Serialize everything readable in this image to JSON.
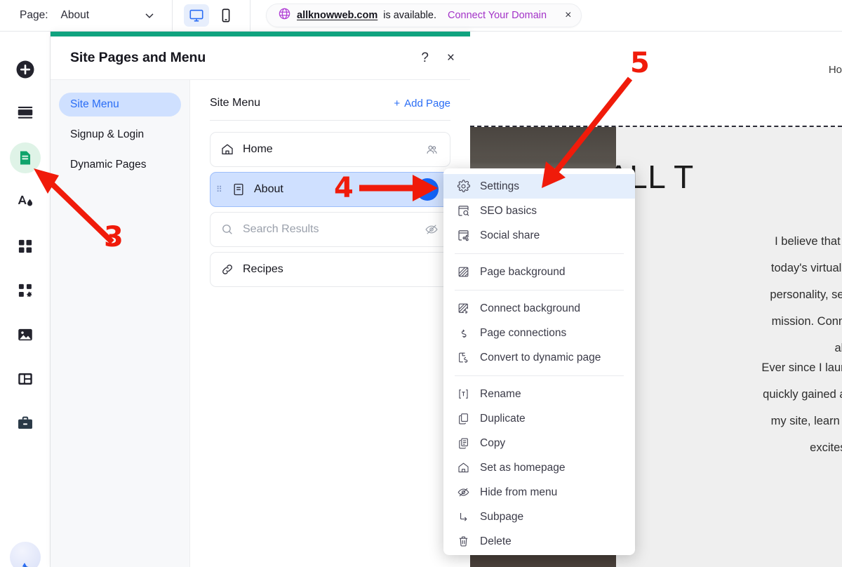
{
  "topbar": {
    "page_label": "Page:",
    "page_value": "About",
    "chevron_icon": "chevron-down-icon",
    "desktop_icon": "desktop-monitor-icon",
    "mobile_icon": "mobile-phone-icon",
    "domain": {
      "globe_icon": "globe-icon",
      "name": "allknowweb.com",
      "availability": "is available.",
      "cta": "Connect Your Domain",
      "close_icon": "×"
    }
  },
  "rail": {
    "items": [
      {
        "name": "add-icon",
        "label": "Add"
      },
      {
        "name": "sections-icon",
        "label": "Sections"
      },
      {
        "name": "pages-icon",
        "label": "Pages",
        "active": true
      },
      {
        "name": "theme-icon",
        "label": "Site Design"
      },
      {
        "name": "apps-icon",
        "label": "Apps"
      },
      {
        "name": "add-apps-icon",
        "label": "Add Apps"
      },
      {
        "name": "media-icon",
        "label": "Media"
      },
      {
        "name": "cms-icon",
        "label": "Content"
      },
      {
        "name": "business-icon",
        "label": "Business Tools"
      }
    ],
    "avatar": "user-avatar"
  },
  "panel": {
    "accent_color": "#10a37f",
    "title": "Site Pages and Menu",
    "help_icon": "?",
    "close_icon": "×",
    "nav": [
      {
        "label": "Site Menu",
        "active": true
      },
      {
        "label": "Signup & Login",
        "active": false
      },
      {
        "label": "Dynamic Pages",
        "active": false
      }
    ],
    "main": {
      "heading": "Site Menu",
      "add_page": "Add Page",
      "plus_icon": "+",
      "pages": [
        {
          "icon": "home-icon",
          "label": "Home",
          "right_icon": "members-icon",
          "state": "normal"
        },
        {
          "icon": "page-icon",
          "label": "About",
          "right_icon": "more-actions-icon",
          "state": "selected"
        },
        {
          "icon": "search-icon",
          "label": "Search Results",
          "right_icon": "hidden-eye-icon",
          "state": "muted"
        },
        {
          "icon": "link-icon",
          "label": "Recipes",
          "right_icon": "",
          "state": "normal"
        }
      ]
    }
  },
  "context_menu": {
    "groups": [
      {
        "items": [
          {
            "icon": "gear-icon",
            "label": "Settings",
            "highlighted": true
          },
          {
            "icon": "seo-icon",
            "label": "SEO basics",
            "highlighted": false
          },
          {
            "icon": "social-share-icon",
            "label": "Social share",
            "highlighted": false
          }
        ]
      },
      {
        "items": [
          {
            "icon": "page-background-icon",
            "label": "Page background",
            "highlighted": false
          }
        ]
      },
      {
        "items": [
          {
            "icon": "connect-background-icon",
            "label": "Connect background",
            "highlighted": false
          },
          {
            "icon": "page-connections-icon",
            "label": "Page connections",
            "highlighted": false
          },
          {
            "icon": "convert-dynamic-icon",
            "label": "Convert to dynamic page",
            "highlighted": false
          }
        ]
      },
      {
        "items": [
          {
            "icon": "rename-icon",
            "label": "Rename",
            "highlighted": false
          },
          {
            "icon": "duplicate-icon",
            "label": "Duplicate",
            "highlighted": false
          },
          {
            "icon": "copy-icon",
            "label": "Copy",
            "highlighted": false
          },
          {
            "icon": "home-icon",
            "label": "Set as homepage",
            "highlighted": false
          },
          {
            "icon": "hide-eye-icon",
            "label": "Hide from menu",
            "highlighted": false
          },
          {
            "icon": "subpage-icon",
            "label": "Subpage",
            "highlighted": false
          },
          {
            "icon": "trash-icon",
            "label": "Delete",
            "highlighted": false
          }
        ]
      }
    ]
  },
  "preview": {
    "nav_text": "Ho",
    "heading": "ALL T",
    "paragraph1": [
      "I believe that being candid",
      "today's virtual world. My blo",
      "personality, sense of humor,",
      "mission. Connecting with th",
      "all."
    ],
    "paragraph2": [
      "Ever since I launched this proje",
      "quickly gained a loyal following",
      "my site, learn more about w",
      "excites and i"
    ]
  },
  "annotations": {
    "color": "#f01b0a",
    "markers": [
      {
        "number": "3",
        "target": "pages-rail-icon"
      },
      {
        "number": "4",
        "target": "about-page-more-actions"
      },
      {
        "number": "5",
        "target": "settings-menu-item"
      }
    ]
  }
}
